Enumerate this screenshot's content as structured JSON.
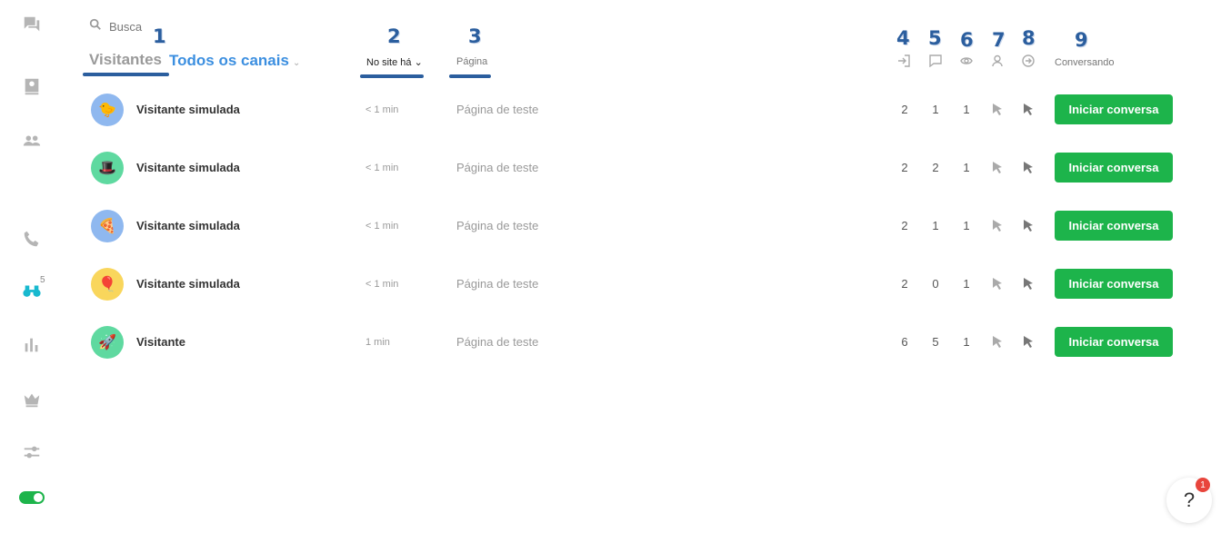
{
  "search": {
    "placeholder": "Busca"
  },
  "header": {
    "title": "Visitantes",
    "channel_selector": "Todos os canais",
    "col_time": "No site há",
    "col_page": "Página",
    "col_chatting": "Conversando"
  },
  "annotations": [
    "1",
    "2",
    "3",
    "4",
    "5",
    "6",
    "7",
    "8",
    "9"
  ],
  "sidebar": {
    "visitors_badge": "5"
  },
  "rows": [
    {
      "name": "Visitante simulada",
      "time": "< 1 min",
      "page": "Página de teste",
      "entries": "2",
      "chats": "1",
      "views": "1",
      "action": "Iniciar conversa",
      "avatar_color": "#8fb8ef",
      "avatar_icon": "bird-icon"
    },
    {
      "name": "Visitante simulada",
      "time": "< 1 min",
      "page": "Página de teste",
      "entries": "2",
      "chats": "2",
      "views": "1",
      "action": "Iniciar conversa",
      "avatar_color": "#5fd9a0",
      "avatar_icon": "top-hat-icon"
    },
    {
      "name": "Visitante simulada",
      "time": "< 1 min",
      "page": "Página de teste",
      "entries": "2",
      "chats": "1",
      "views": "1",
      "action": "Iniciar conversa",
      "avatar_color": "#8fb8ef",
      "avatar_icon": "pizza-icon"
    },
    {
      "name": "Visitante simulada",
      "time": "< 1 min",
      "page": "Página de teste",
      "entries": "2",
      "chats": "0",
      "views": "1",
      "action": "Iniciar conversa",
      "avatar_color": "#f9d65c",
      "avatar_icon": "balloon-icon"
    },
    {
      "name": "Visitante",
      "time": "1 min",
      "page": "Página de teste",
      "entries": "6",
      "chats": "5",
      "views": "1",
      "action": "Iniciar conversa",
      "avatar_color": "#5fd9a0",
      "avatar_icon": "rocket-icon"
    }
  ],
  "help": {
    "label": "?",
    "badge": "1"
  },
  "colors": {
    "accent": "#1db44b",
    "link": "#3c8fe0",
    "annotation": "#2b5e9e",
    "active_icon": "#18b9cf"
  }
}
